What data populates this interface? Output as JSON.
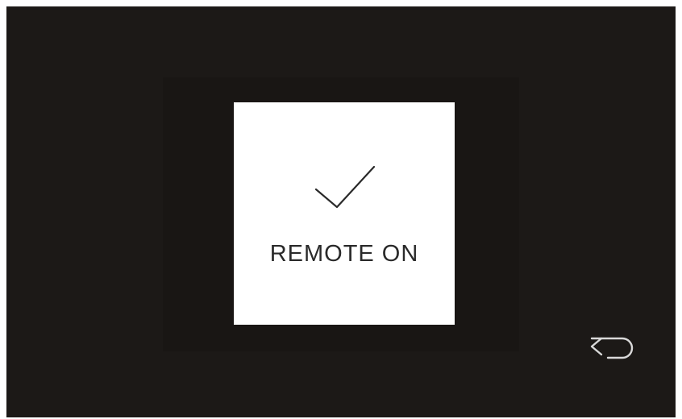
{
  "dialog": {
    "icon": "checkmark-icon",
    "message": "REMOTE ON"
  },
  "navigation": {
    "back_icon": "back-arrow-icon"
  },
  "colors": {
    "screen_background": "#1c1917",
    "dialog_background": "#ffffff",
    "text": "#2a2a2a",
    "icon_stroke": "#d9d9d9"
  }
}
